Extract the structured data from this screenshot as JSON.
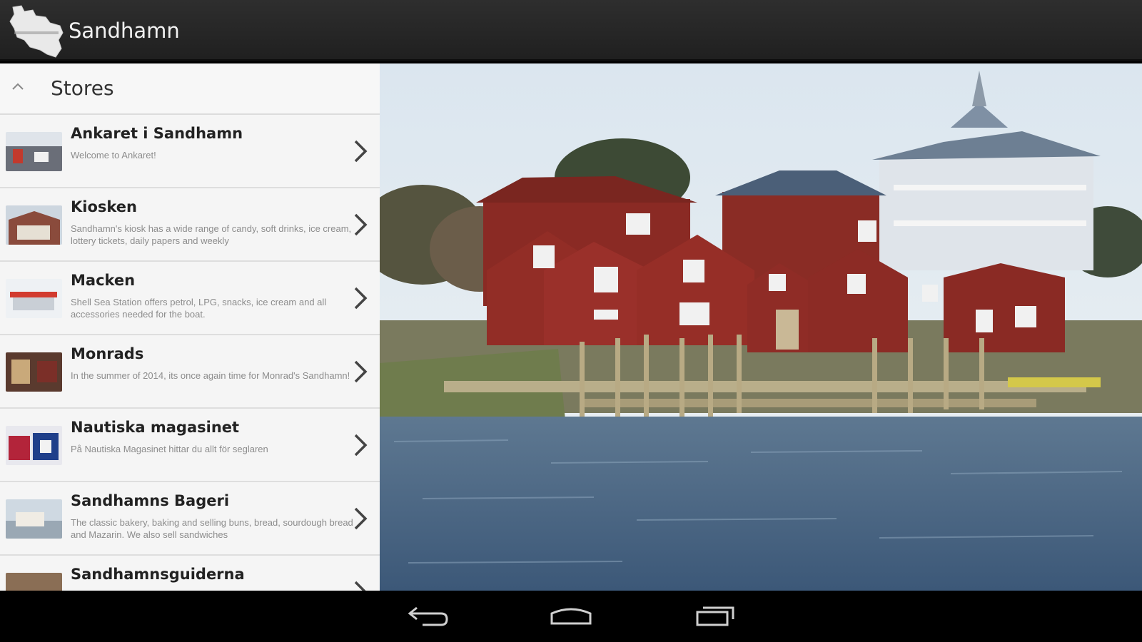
{
  "app": {
    "title": "Sandhamn",
    "logo_icon": "island-map-logo-icon"
  },
  "list": {
    "header_title": "Stores",
    "items": [
      {
        "name": "Ankaret i Sandhamn",
        "description": "Welcome to Ankaret!",
        "thumb_color": "#6a6e78"
      },
      {
        "name": "Kiosken",
        "description": "Sandhamn's kiosk has a wide range of candy, soft drinks, ice cream, lottery tickets, daily papers and weekly",
        "thumb_color": "#8a4b3c"
      },
      {
        "name": "Macken",
        "description": "Shell Sea Station offers petrol, LPG, snacks, ice cream and all accessories needed for the boat.",
        "thumb_color": "#c9cfd6"
      },
      {
        "name": "Monrads",
        "description": "In the summer of 2014, its once again time for Monrad's Sandhamn!",
        "thumb_color": "#5a3a2e"
      },
      {
        "name": "Nautiska magasinet",
        "description": "På Nautiska Magasinet hittar du allt för seglaren",
        "thumb_color": "#b3243a"
      },
      {
        "name": "Sandhamns Bageri",
        "description": "The classic bakery, baking and selling buns, bread, sourdough bread and Mazarin. We also sell sandwiches",
        "thumb_color": "#9aa8b4"
      },
      {
        "name": "Sandhamnsguiderna",
        "description": "",
        "thumb_color": "#8a6e55"
      }
    ]
  },
  "colors": {
    "action_bar": "#262626",
    "list_background": "#f4f4f4",
    "divider": "#dedede",
    "title_text": "#f2f2f2"
  }
}
